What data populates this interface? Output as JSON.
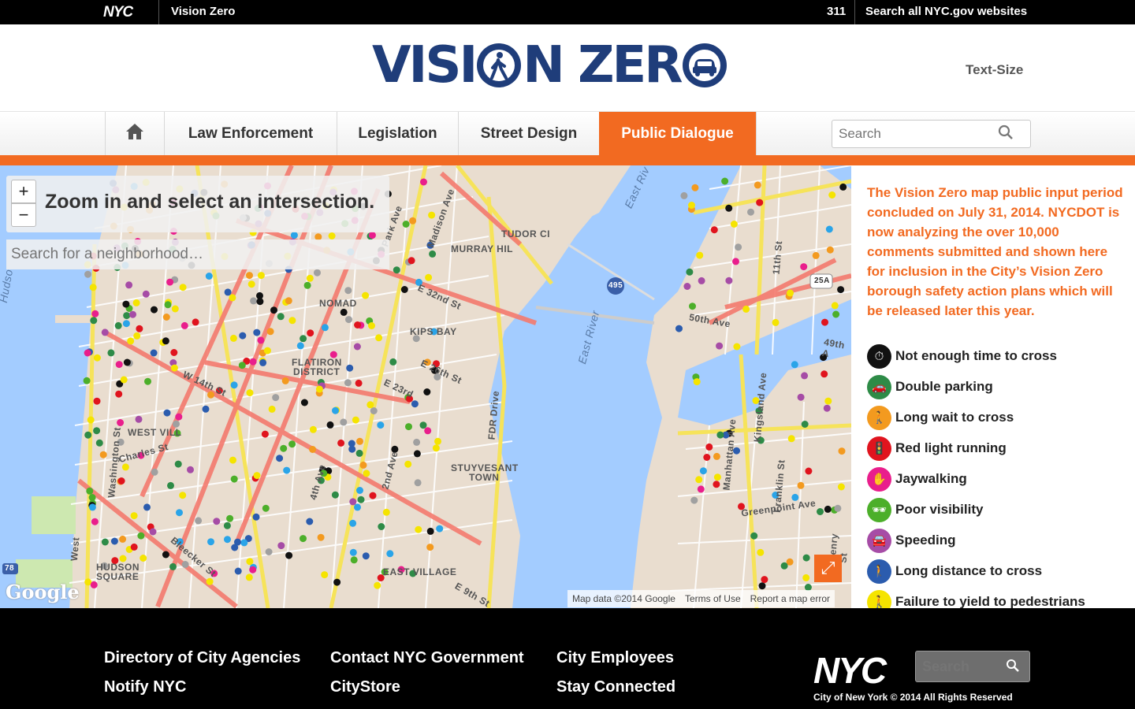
{
  "topbar": {
    "nyc_logo": "NYC",
    "site_name": "Vision Zero",
    "link_311": "311",
    "search_all": "Search all NYC.gov websites"
  },
  "header": {
    "brand_part1": "VISI",
    "brand_part2": "N ZER",
    "text_size": "Text-Size"
  },
  "nav": {
    "home_icon": "home-icon",
    "items": [
      {
        "label": "Law Enforcement",
        "active": false
      },
      {
        "label": "Legislation",
        "active": false
      },
      {
        "label": "Street Design",
        "active": false
      },
      {
        "label": "Public Dialogue",
        "active": true
      }
    ],
    "search_placeholder": "Search",
    "accent_color": "#f26a21"
  },
  "map": {
    "zoom_in": "+",
    "zoom_out": "−",
    "zoom_message": "Zoom in and select an intersection.",
    "neighborhood_placeholder": "Search for a neighborhood…",
    "google_logo": "Google",
    "attribution": {
      "data": "Map data ©2014 Google",
      "terms": "Terms of Use",
      "report": "Report a map error"
    },
    "labels": {
      "madison_ave": "Madison Ave",
      "park_ave": "Park Ave",
      "tudor_city": "TUDOR CI",
      "murray_hill": "MURRAY HIL",
      "e32nd": "E 32nd St",
      "nomad": "NOMAD",
      "kips_bay": "KIPS BAY",
      "e26th": "E 26th St",
      "flatiron": "FLATIRON",
      "district": "DISTRICT",
      "w14th": "W 14th St",
      "e23rd": "E 23rd",
      "west_village": "WEST VILL",
      "charles_st": "Charles St",
      "washington_st": "Washington St",
      "stuyvesant": "STUYVESANT",
      "town": "TOWN",
      "ave_4th": "4th Ave",
      "ave_2nd": "2nd Ave",
      "fdr": "FDR Drive",
      "east_village": "EAST VILLAGE",
      "e9th": "E 9th St",
      "hudson": "HUDSON",
      "square": "SQUARE",
      "bleecker": "Bleecker St",
      "east_river_1": "East River",
      "east_river_2": "East Riv",
      "hudson_river": "Hudso",
      "i495": "495",
      "r25a": "25A",
      "r78": "78",
      "e50th": "50th Ave",
      "e49th": "49th A",
      "manhattan_ave": "Manhattan Ave",
      "franklin": "Franklin St",
      "greenpoint": "Greenpoint Ave",
      "n_henry": "N Henry St",
      "kingsland": "Kingsland Ave",
      "st_11th": "11th St",
      "west": "West"
    }
  },
  "sidepanel": {
    "notice": "The Vision Zero map public input period concluded on July 31, 2014. NYCDOT is now analyzing the over 10,000 comments submitted and shown here for inclusion in the City’s Vision Zero borough safety action plans which will be released later this year.",
    "legend": [
      {
        "label": "Not enough time to cross",
        "color": "#111111",
        "icon": "timer-icon",
        "glyph": "⏱"
      },
      {
        "label": "Double parking",
        "color": "#2e8b47",
        "icon": "double-parking-icon",
        "glyph": "🚗"
      },
      {
        "label": "Long wait to cross",
        "color": "#f39a1f",
        "icon": "long-wait-icon",
        "glyph": "🚶"
      },
      {
        "label": "Red light running",
        "color": "#e0141e",
        "icon": "traffic-light-icon",
        "glyph": "🚦"
      },
      {
        "label": "Jaywalking",
        "color": "#e91e8c",
        "icon": "hand-stop-icon",
        "glyph": "✋"
      },
      {
        "label": "Poor visibility",
        "color": "#4caf2a",
        "icon": "sunglasses-icon",
        "glyph": "🕶"
      },
      {
        "label": "Speeding",
        "color": "#a64ca6",
        "icon": "speeding-car-icon",
        "glyph": "🚘"
      },
      {
        "label": "Long distance to cross",
        "color": "#2b5cae",
        "icon": "long-distance-icon",
        "glyph": "🚶"
      },
      {
        "label": "Failure to yield to pedestrians",
        "color": "#f5e400",
        "icon": "yield-icon",
        "glyph": "🚶"
      }
    ]
  },
  "footer": {
    "links": [
      "Directory of City Agencies",
      "Contact NYC Government",
      "City Employees",
      "Notify NYC",
      "CityStore",
      "Stay Connected"
    ],
    "logo": "NYC",
    "search_placeholder": "Search",
    "copyright": "City of New York © 2014 All Rights Reserved"
  }
}
